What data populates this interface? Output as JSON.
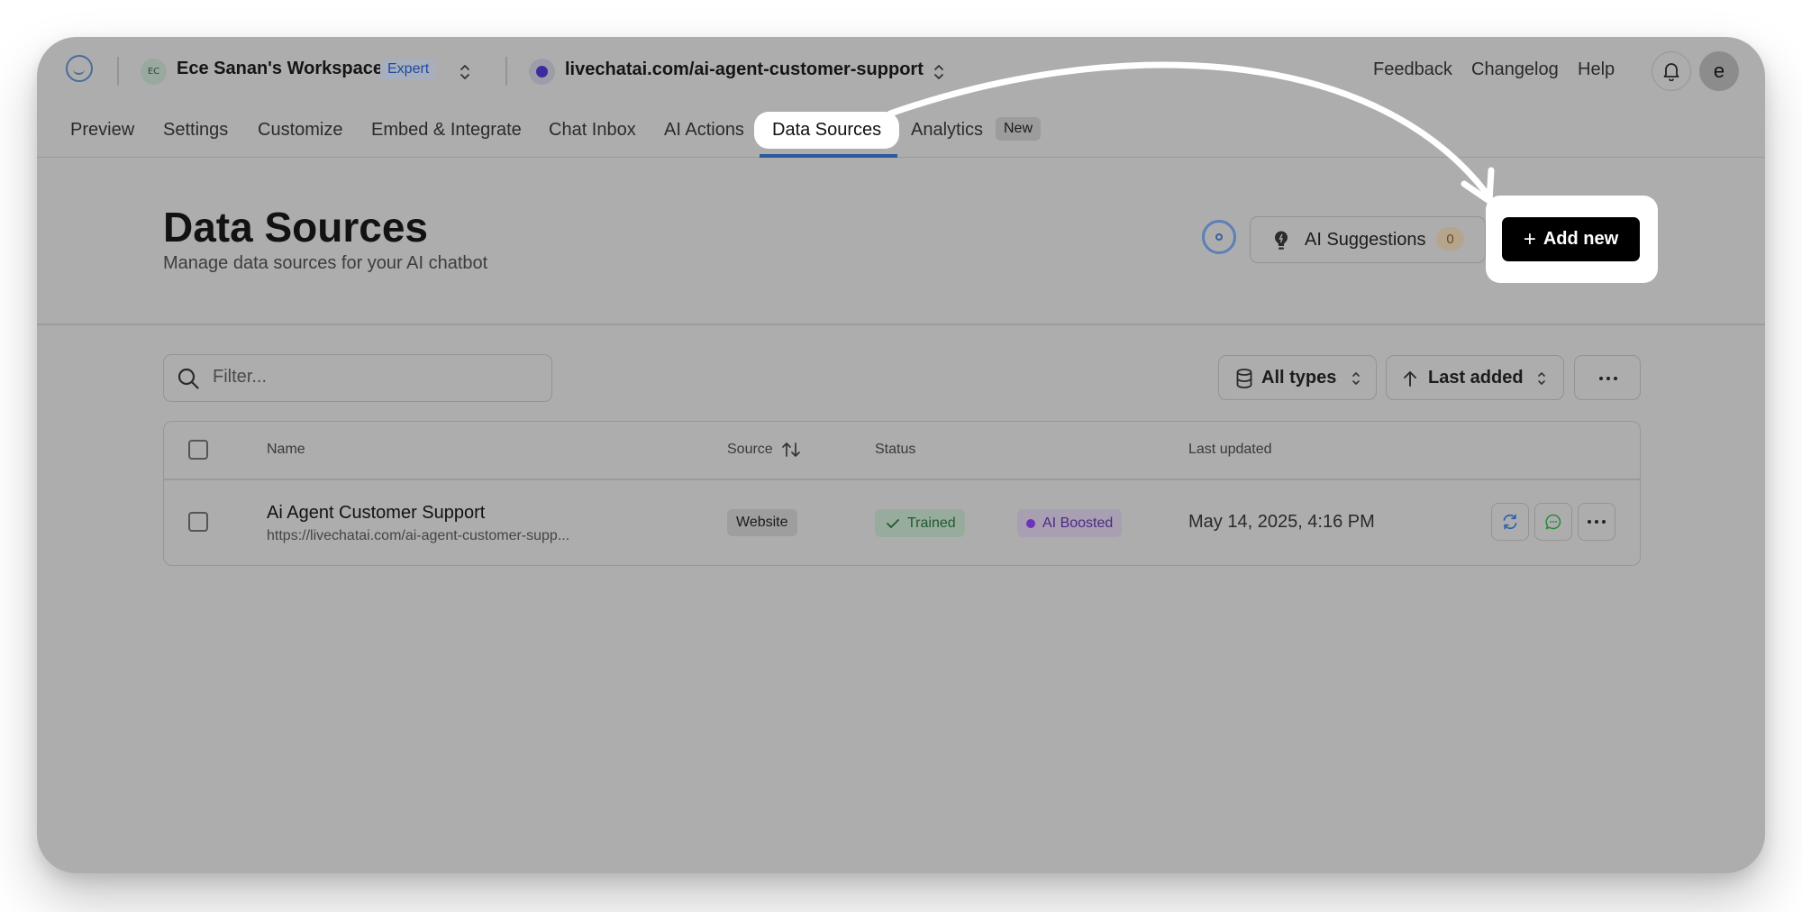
{
  "header": {
    "workspace_initials": "EC",
    "workspace_name": "Ece Sanan's Workspace",
    "plan_badge": "Expert",
    "site_url": "livechatai.com/ai-agent-customer-support",
    "links": {
      "feedback": "Feedback",
      "changelog": "Changelog",
      "help": "Help"
    },
    "avatar_letter": "e"
  },
  "nav": {
    "tabs": [
      "Preview",
      "Settings",
      "Customize",
      "Embed & Integrate",
      "Chat Inbox",
      "AI Actions",
      "Data Sources",
      "Analytics"
    ],
    "active_tab": "Data Sources",
    "new_badge": "New"
  },
  "page": {
    "title": "Data Sources",
    "subtitle": "Manage data sources for your AI chatbot",
    "ai_suggestions_label": "AI Suggestions",
    "ai_suggestions_count": "0",
    "add_new_label": "Add new"
  },
  "toolbar": {
    "filter_placeholder": "Filter...",
    "type_filter": "All types",
    "sort": "Last added"
  },
  "table": {
    "columns": [
      "Name",
      "Source",
      "Status",
      "Last updated"
    ],
    "rows": [
      {
        "name": "Ai Agent Customer Support",
        "url": "https://livechatai.com/ai-agent-customer-supp...",
        "source": "Website",
        "statuses": [
          "Trained",
          "AI Boosted"
        ],
        "last_updated": "May 14, 2025, 4:16 PM"
      }
    ]
  },
  "colors": {
    "overlay": "#adadad",
    "primary_button": "#000000",
    "active_tab_underline": "#2e5a9c",
    "trained_text": "#1e5a2b",
    "boosted_text": "#4b2a85"
  }
}
